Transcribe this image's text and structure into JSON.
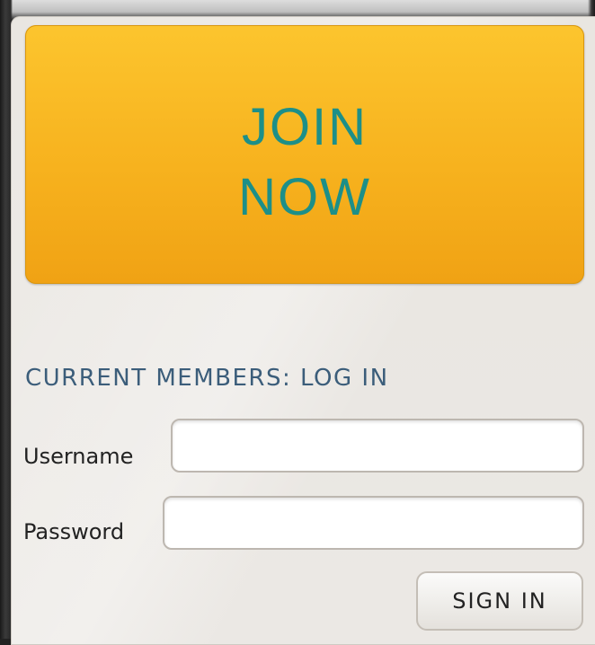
{
  "join": {
    "line1": "JOIN",
    "line2": "NOW"
  },
  "login": {
    "section_title": "CURRENT MEMBERS: LOG IN",
    "username_label": "Username",
    "username_value": "",
    "password_label": "Password",
    "password_value": "",
    "signin_label": "SIGN IN"
  },
  "colors": {
    "join_button": "#f7b21e",
    "join_text": "#1d8f88",
    "section_title": "#3b5d7a",
    "panel_background": "#e9e6e1"
  }
}
